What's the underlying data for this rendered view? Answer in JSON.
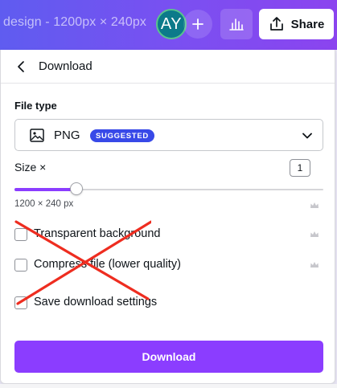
{
  "topbar": {
    "doc_title": "design - 1200px × 240px",
    "avatar_initials": "AY",
    "share_label": "Share"
  },
  "panel": {
    "title": "Download",
    "file_type_label": "File type",
    "file_type_value": "PNG",
    "suggested_badge": "SUGGESTED",
    "size_label": "Size ×",
    "size_value": "1",
    "size_slider_fraction": 0.2,
    "dimensions": "1200 × 240 px",
    "options": [
      {
        "label": "Transparent background",
        "checked": false,
        "pro": true
      },
      {
        "label": "Compress file (lower quality)",
        "checked": false,
        "pro": true
      },
      {
        "label": "Save download settings",
        "checked": false,
        "pro": false
      }
    ],
    "download_label": "Download"
  },
  "colors": {
    "accent": "#8b3dff",
    "badge": "#3849e8",
    "annotation_x": "#ee2d20"
  },
  "icons": [
    "back-chevron-icon",
    "image-icon",
    "chevron-down-icon",
    "crown-icon",
    "plus-icon",
    "bar-chart-icon",
    "share-upload-icon"
  ]
}
